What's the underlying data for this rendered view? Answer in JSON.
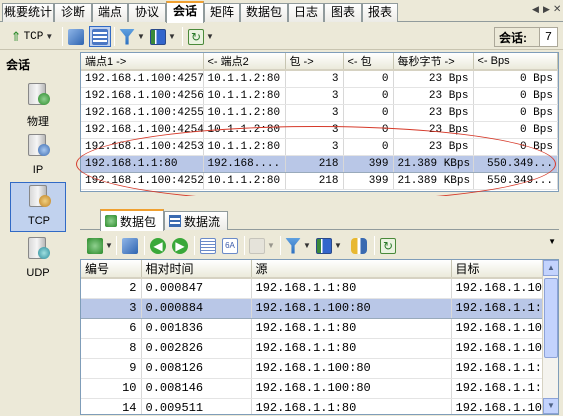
{
  "tabs": [
    "概要统计",
    "诊断",
    "端点",
    "协议",
    "会话",
    "矩阵",
    "数据包",
    "日志",
    "图表",
    "报表"
  ],
  "active_tab": "会话",
  "toolbar": {
    "protocol_select": "TCP",
    "session_label": "会话:",
    "session_count": "7"
  },
  "left_pane": {
    "title": "会话",
    "items": [
      {
        "label": "物理",
        "icon": "physical-host-icon"
      },
      {
        "label": "IP",
        "icon": "ip-host-icon"
      },
      {
        "label": "TCP",
        "icon": "tcp-host-icon"
      },
      {
        "label": "UDP",
        "icon": "udp-host-icon"
      }
    ],
    "selected": "TCP"
  },
  "session_table": {
    "columns": [
      "端点1 ->",
      "<- 端点2",
      "包 ->",
      "<- 包",
      "每秒字节 ->",
      "<- Bps"
    ],
    "rows": [
      [
        "192.168.1.100:4257",
        "10.1.1.2:80",
        "3",
        "0",
        "23 Bps",
        "0 Bps"
      ],
      [
        "192.168.1.100:4256",
        "10.1.1.2:80",
        "3",
        "0",
        "23 Bps",
        "0 Bps"
      ],
      [
        "192.168.1.100:4255",
        "10.1.1.2:80",
        "3",
        "0",
        "23 Bps",
        "0 Bps"
      ],
      [
        "192.168.1.100:4254",
        "10.1.1.2:80",
        "3",
        "0",
        "23 Bps",
        "0 Bps"
      ],
      [
        "192.168.1.100:4253",
        "10.1.1.2:80",
        "3",
        "0",
        "23 Bps",
        "0 Bps"
      ],
      [
        "192.168.1.1:80",
        "192.168....",
        "218",
        "399",
        "21.389 KBps",
        "550.349..."
      ],
      [
        "192.168.1.100:4252",
        "10.1.1.2:80",
        "218",
        "399",
        "21.389 KBps",
        "550.349..."
      ]
    ],
    "highlighted_row": 5
  },
  "sub_tabs": [
    "数据包",
    "数据流"
  ],
  "active_sub_tab": "数据包",
  "packet_table": {
    "columns": [
      "编号",
      "相对时间",
      "源",
      "目标"
    ],
    "rows": [
      [
        "2",
        "0.000847",
        "192.168.1.1:80",
        "192.168.1.10"
      ],
      [
        "3",
        "0.000884",
        "192.168.1.100:80",
        "192.168.1.1:8"
      ],
      [
        "6",
        "0.001836",
        "192.168.1.1:80",
        "192.168.1.10"
      ],
      [
        "8",
        "0.002826",
        "192.168.1.1:80",
        "192.168.1.10"
      ],
      [
        "9",
        "0.008126",
        "192.168.1.100:80",
        "192.168.1.1:8"
      ],
      [
        "10",
        "0.008146",
        "192.168.1.100:80",
        "192.168.1.1:8"
      ],
      [
        "14",
        "0.009511",
        "192.168.1.1:80",
        "192.168.1.10"
      ]
    ],
    "highlighted_row": 1
  },
  "colors": {
    "highlight": "#b9c7e7",
    "annotation": "#d63a2a",
    "accent_tab": "#f0a030"
  }
}
